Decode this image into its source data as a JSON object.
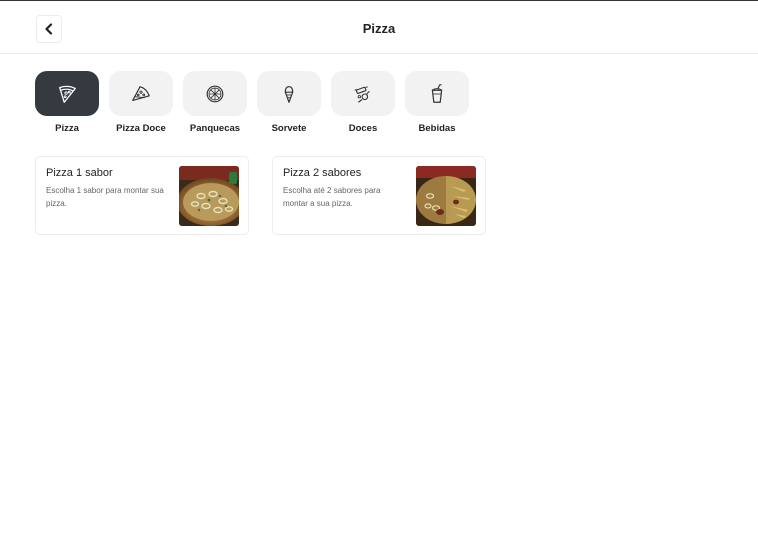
{
  "header": {
    "title": "Pizza",
    "back_icon": "chevron-left-icon"
  },
  "categories": [
    {
      "label": "Pizza",
      "icon": "pizza-slice-icon",
      "active": true
    },
    {
      "label": "Pizza Doce",
      "icon": "sweet-pizza-icon",
      "active": false
    },
    {
      "label": "Panquecas",
      "icon": "pancake-icon",
      "active": false
    },
    {
      "label": "Sorvete",
      "icon": "ice-cream-icon",
      "active": false
    },
    {
      "label": "Doces",
      "icon": "candy-icon",
      "active": false
    },
    {
      "label": "Bebidas",
      "icon": "drink-cup-icon",
      "active": false
    }
  ],
  "products": [
    {
      "title": "Pizza 1 sabor",
      "description": "Escolha 1 sabor para montar sua pizza.",
      "image": "pizza-photo"
    },
    {
      "title": "Pizza 2 sabores",
      "description": "Escolha até 2 sabores para montar a sua pizza.",
      "image": "pizza-half-half-photo"
    }
  ],
  "colors": {
    "active_category": "#353a40",
    "category_bg": "#f2f2f2",
    "card_border": "#ececec"
  }
}
